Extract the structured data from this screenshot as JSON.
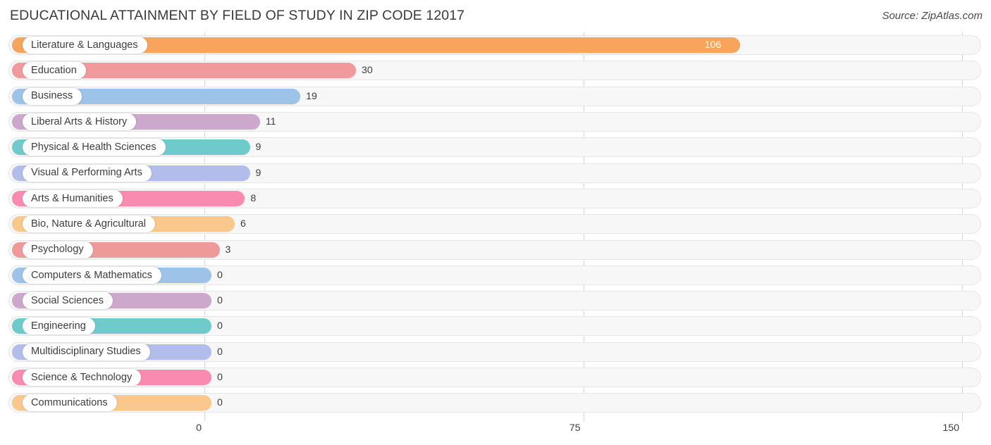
{
  "header": {
    "title": "EDUCATIONAL ATTAINMENT BY FIELD OF STUDY IN ZIP CODE 12017",
    "source": "Source: ZipAtlas.com"
  },
  "chart_data": {
    "type": "bar",
    "orientation": "horizontal",
    "title": "EDUCATIONAL ATTAINMENT BY FIELD OF STUDY IN ZIP CODE 12017",
    "xlabel": "",
    "ylabel": "",
    "xlim": [
      0,
      150
    ],
    "xticks": [
      0,
      75,
      150
    ],
    "xtick_labels": [
      "0",
      "75",
      "150"
    ],
    "grid": true,
    "legend": false,
    "categories": [
      "Literature & Languages",
      "Education",
      "Business",
      "Liberal Arts & History",
      "Physical & Health Sciences",
      "Visual & Performing Arts",
      "Arts & Humanities",
      "Bio, Nature & Agricultural",
      "Psychology",
      "Computers & Mathematics",
      "Social Sciences",
      "Engineering",
      "Multidisciplinary Studies",
      "Science & Technology",
      "Communications"
    ],
    "values": [
      106,
      30,
      19,
      11,
      9,
      9,
      8,
      6,
      3,
      0,
      0,
      0,
      0,
      0,
      0
    ],
    "value_labels": [
      "106",
      "30",
      "19",
      "11",
      "9",
      "9",
      "8",
      "6",
      "3",
      "0",
      "0",
      "0",
      "0",
      "0",
      "0"
    ],
    "colors": [
      "#F8A45C",
      "#F09A9D",
      "#9DC3E9",
      "#CBA8CC",
      "#6FCBCB",
      "#B3BDEC",
      "#F98BB0",
      "#FAC88C",
      "#EF9A9A",
      "#9DC3E9",
      "#CBA8CC",
      "#6FCBCB",
      "#B3BDEC",
      "#F98BB0",
      "#FAC88C"
    ]
  }
}
